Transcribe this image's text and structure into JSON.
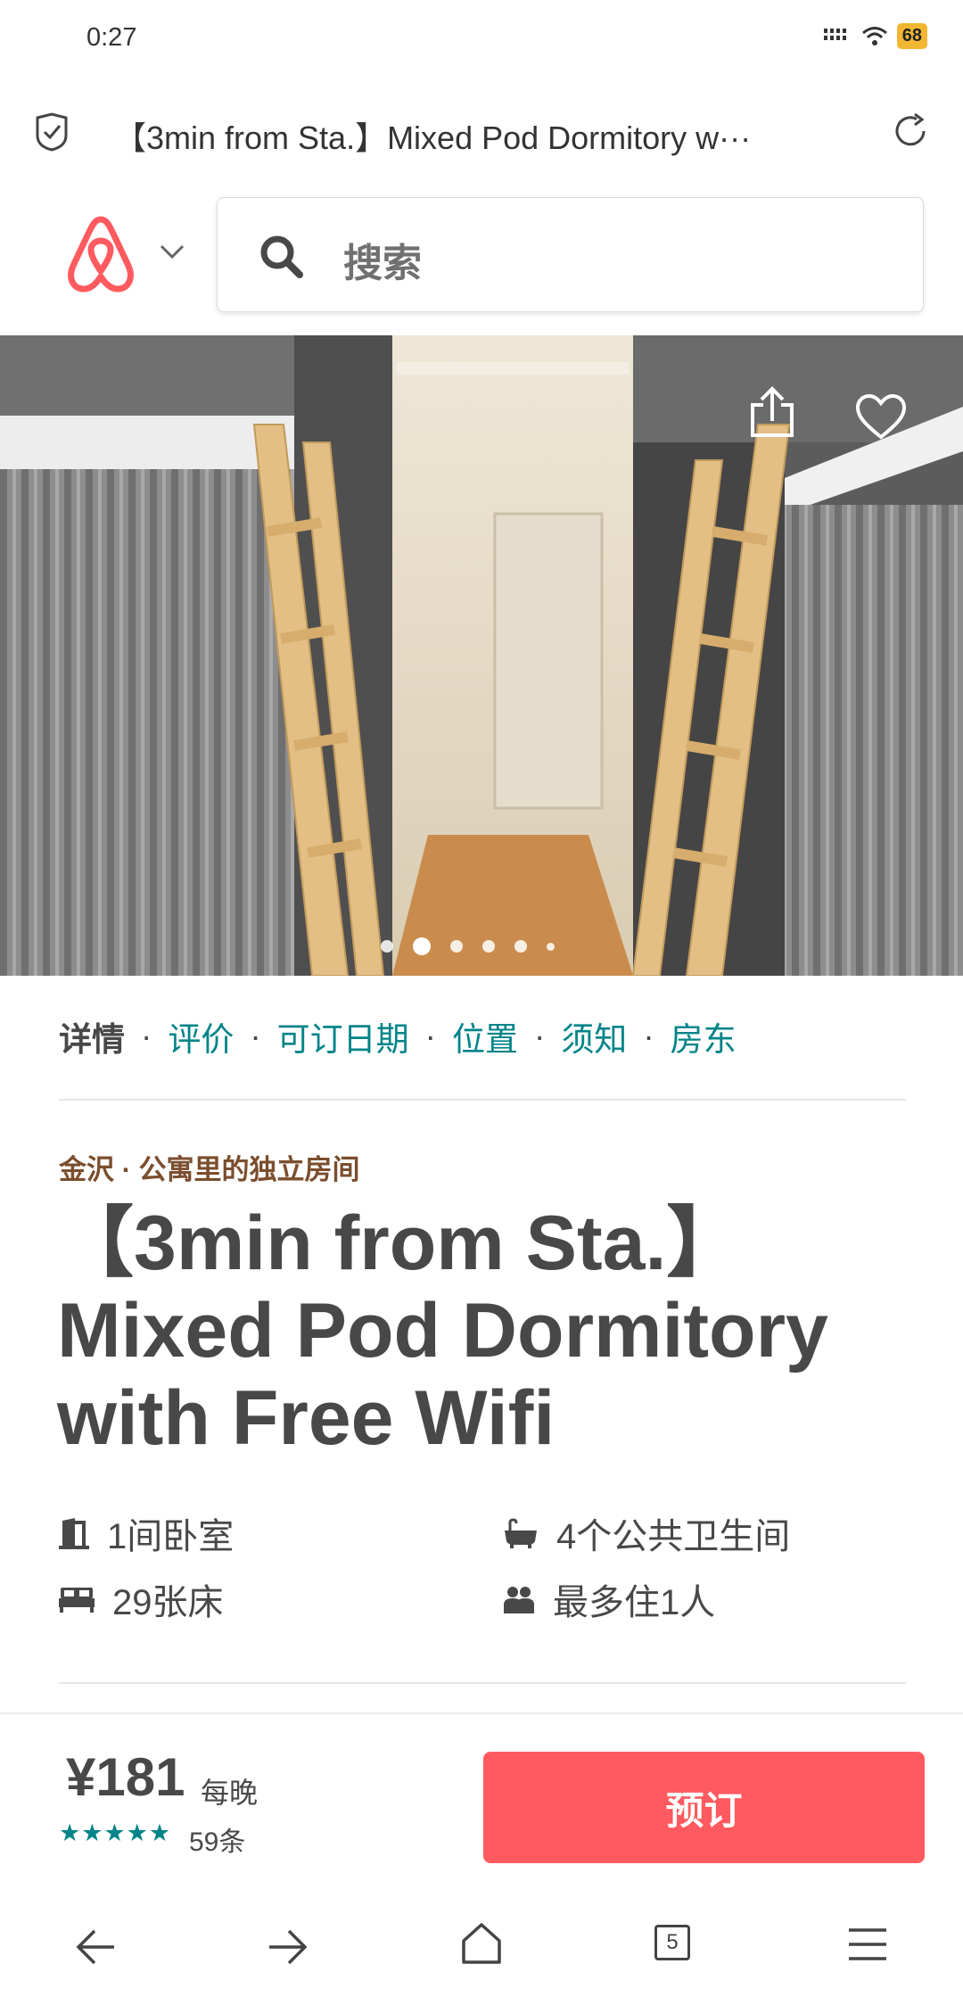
{
  "status_bar": {
    "time": "0:27",
    "battery": "68"
  },
  "browser": {
    "page_title": "【3min from Sta.】Mixed Pod Dormitory w···",
    "tab_count": "5"
  },
  "search": {
    "placeholder": "搜索"
  },
  "hero": {
    "slide_count": 6,
    "active_index": 1
  },
  "tabs": [
    {
      "label": "详情",
      "active": true
    },
    {
      "label": "评价",
      "active": false
    },
    {
      "label": "可订日期",
      "active": false
    },
    {
      "label": "位置",
      "active": false
    },
    {
      "label": "须知",
      "active": false
    },
    {
      "label": "房东",
      "active": false
    }
  ],
  "tab_separator": "·",
  "listing": {
    "category": "金沢 · 公寓里的独立房间",
    "title": "【3min from Sta.】Mixed Pod Dormitory with Free Wifi",
    "amenities": [
      {
        "icon": "door-icon",
        "label": "1间卧室"
      },
      {
        "icon": "bathtub-icon",
        "label": "4个公共卫生间"
      },
      {
        "icon": "bed-icon",
        "label": "29张床"
      },
      {
        "icon": "guests-icon",
        "label": "最多住1人"
      }
    ]
  },
  "booking": {
    "price": "¥181",
    "per_night": "每晚",
    "stars": "★★★★★",
    "review_count": "59条",
    "book_label": "预订"
  },
  "colors": {
    "brand": "#ff5a5f",
    "link": "#008489",
    "category": "#7b4e2e"
  }
}
